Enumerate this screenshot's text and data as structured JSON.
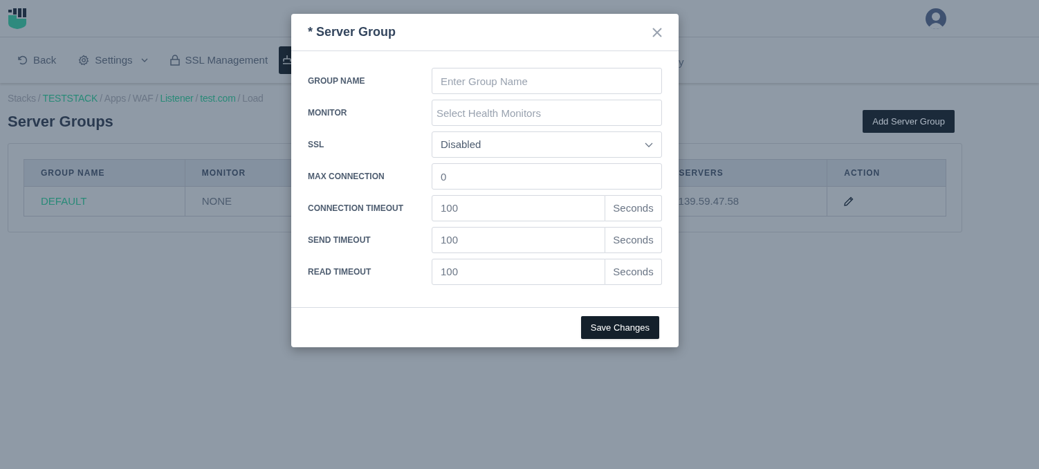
{
  "toolbar": {
    "items": [
      {
        "kind": "back",
        "label": "Back"
      },
      {
        "kind": "settings",
        "label": "Settings"
      },
      {
        "kind": "lock",
        "label": "SSL Management"
      },
      {
        "kind": "active-icon",
        "selected": true
      },
      {
        "kind": "text",
        "label": "y"
      }
    ]
  },
  "breadcrumb": {
    "separator": "/",
    "items": [
      {
        "label": "Stacks",
        "link": false
      },
      {
        "label": "TESTSTACK",
        "link": true
      },
      {
        "label": "Apps",
        "link": false
      },
      {
        "label": "WAF",
        "link": false
      },
      {
        "label": "Listener",
        "link": true
      },
      {
        "label": "test.com",
        "link": true
      },
      {
        "label": "Load",
        "link": false
      }
    ]
  },
  "page_title": "Server Groups",
  "add_button": "Add Server Group",
  "table": {
    "columns": [
      "GROUP NAME",
      "MONITOR",
      "",
      "SERVERS",
      "ACTION"
    ],
    "rows": [
      {
        "group_name": "DEFAULT",
        "monitor": "NONE",
        "servers": "139.59.47.58"
      }
    ]
  },
  "modal": {
    "title": "* Server Group",
    "fields": [
      {
        "kind": "text",
        "label": "GROUP NAME",
        "placeholder": "Enter Group Name"
      },
      {
        "kind": "multiselect",
        "label": "MONITOR",
        "placeholder": "Select Health Monitors"
      },
      {
        "kind": "select",
        "label": "SSL",
        "value": "Disabled"
      },
      {
        "kind": "text",
        "label": "MAX CONNECTION",
        "value": "0"
      },
      {
        "kind": "unit",
        "label": "CONNECTION TIMEOUT",
        "value": "100",
        "unit": "Seconds"
      },
      {
        "kind": "unit",
        "label": "SEND TIMEOUT",
        "value": "100",
        "unit": "Seconds"
      },
      {
        "kind": "unit",
        "label": "READ TIMEOUT",
        "value": "100",
        "unit": "Seconds"
      }
    ],
    "save_button": "Save Changes"
  }
}
